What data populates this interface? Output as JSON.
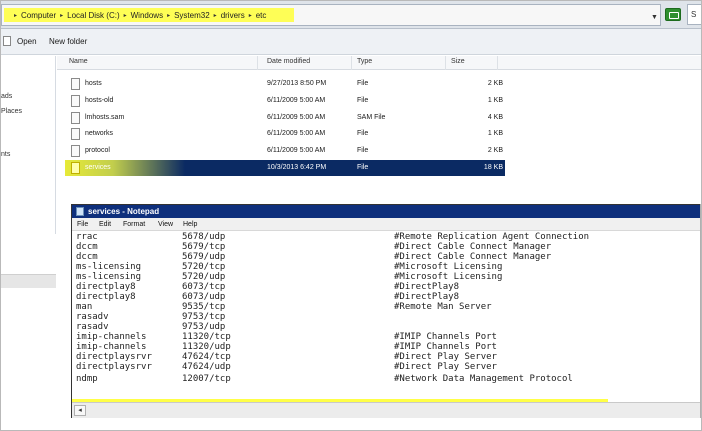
{
  "address": {
    "crumbs": [
      "Computer",
      "Local Disk (C:)",
      "Windows",
      "System32",
      "drivers",
      "etc"
    ],
    "lead_arrow": "▸",
    "separator": "▸",
    "search_text": "S"
  },
  "toolbar": {
    "open_label": "Open",
    "new_folder_label": "New folder"
  },
  "nav": {
    "items": [
      "ads",
      "Places",
      "nts"
    ]
  },
  "columns": {
    "name": "Name",
    "date": "Date modified",
    "type": "Type",
    "size": "Size"
  },
  "files": [
    {
      "name": "hosts",
      "date": "9/27/2013 8:50 PM",
      "type": "File",
      "size": "2 KB"
    },
    {
      "name": "hosts-old",
      "date": "6/11/2009 5:00 AM",
      "type": "File",
      "size": "1 KB"
    },
    {
      "name": "lmhosts.sam",
      "date": "6/11/2009 5:00 AM",
      "type": "SAM File",
      "size": "4 KB"
    },
    {
      "name": "networks",
      "date": "6/11/2009 5:00 AM",
      "type": "File",
      "size": "1 KB"
    },
    {
      "name": "protocol",
      "date": "6/11/2009 5:00 AM",
      "type": "File",
      "size": "2 KB"
    },
    {
      "name": "services",
      "date": "10/3/2013 6:42 PM",
      "type": "File",
      "size": "18 KB"
    }
  ],
  "notepad": {
    "title": "services - Notepad",
    "menu": [
      "File",
      "Edit",
      "Format",
      "View",
      "Help"
    ],
    "lines": [
      {
        "service": "rrac",
        "port": "5678/udp",
        "comment": "#Remote Replication Agent Connection"
      },
      {
        "service": "dccm",
        "port": "5679/tcp",
        "comment": "#Direct Cable Connect Manager"
      },
      {
        "service": "dccm",
        "port": "5679/udp",
        "comment": "#Direct Cable Connect Manager"
      },
      {
        "service": "ms-licensing",
        "port": "5720/tcp",
        "comment": "#Microsoft Licensing"
      },
      {
        "service": "ms-licensing",
        "port": "5720/udp",
        "comment": "#Microsoft Licensing"
      },
      {
        "service": "directplay8",
        "port": "6073/tcp",
        "comment": "#DirectPlay8"
      },
      {
        "service": "directplay8",
        "port": "6073/udp",
        "comment": "#DirectPlay8"
      },
      {
        "service": "man",
        "port": "9535/tcp",
        "comment": "#Remote Man Server"
      },
      {
        "service": "rasadv",
        "port": "9753/tcp",
        "comment": ""
      },
      {
        "service": "rasadv",
        "port": "9753/udp",
        "comment": ""
      },
      {
        "service": "imip-channels",
        "port": "11320/tcp",
        "comment": "#IMIP Channels Port"
      },
      {
        "service": "imip-channels",
        "port": "11320/udp",
        "comment": "#IMIP Channels Port"
      },
      {
        "service": "directplaysrvr",
        "port": "47624/tcp",
        "comment": "#Direct Play Server"
      },
      {
        "service": "directplaysrvr",
        "port": "47624/udp",
        "comment": "#Direct Play Server"
      },
      {
        "service": "ndmp",
        "port": "12007/tcp",
        "comment": "#Network Data Management Protocol"
      }
    ],
    "scroll_left": "◂"
  },
  "colors": {
    "selection": "#0b2a63",
    "highlight": "#ffff33",
    "notepad_title": "#0e2f7c"
  }
}
